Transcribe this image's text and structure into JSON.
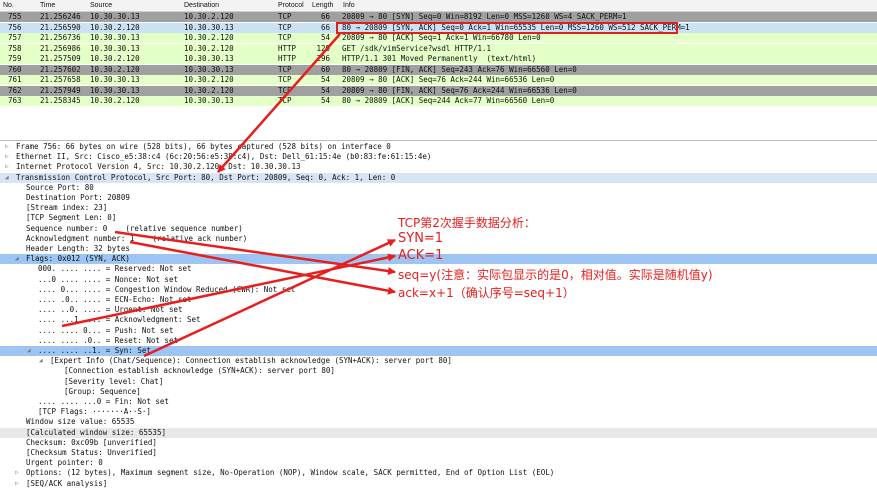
{
  "columns": [
    "No.",
    "Time",
    "Source",
    "Destination",
    "Protocol",
    "Length",
    "Info"
  ],
  "packets": [
    {
      "no": "755",
      "time": "21.256246",
      "src": "10.30.30.13",
      "dst": "10.30.2.120",
      "proto": "TCP",
      "len": "66",
      "info": "20809 → 80 [SYN] Seq=0 Win=8192 Len=0 MSS=1260 WS=4 SACK_PERM=1",
      "bg": "#a0a0a0"
    },
    {
      "no": "756",
      "time": "21.256590",
      "src": "10.30.2.120",
      "dst": "10.30.30.13",
      "proto": "TCP",
      "len": "66",
      "info": "80 → 20809 [SYN, ACK] Seq=0 Ack=1 Win=65535 Len=0 MSS=1260 WS=512 SACK_PERM=1",
      "bg": "#c9e3f5"
    },
    {
      "no": "757",
      "time": "21.256736",
      "src": "10.30.30.13",
      "dst": "10.30.2.120",
      "proto": "TCP",
      "len": "54",
      "info": "20809 → 80 [ACK] Seq=1 Ack=1 Win=66780 Len=0",
      "bg": "#e4ffc7"
    },
    {
      "no": "758",
      "time": "21.256986",
      "src": "10.30.30.13",
      "dst": "10.30.2.120",
      "proto": "HTTP",
      "len": "129",
      "info": "GET /sdk/vimService?wsdl HTTP/1.1",
      "bg": "#e4ffc7"
    },
    {
      "no": "759",
      "time": "21.257509",
      "src": "10.30.2.120",
      "dst": "10.30.30.13",
      "proto": "HTTP",
      "len": "296",
      "info": "HTTP/1.1 301 Moved Permanently  (text/html)",
      "bg": "#e4ffc7"
    },
    {
      "no": "760",
      "time": "21.257602",
      "src": "10.30.2.120",
      "dst": "10.30.30.13",
      "proto": "TCP",
      "len": "60",
      "info": "80 → 20809 [FIN, ACK] Seq=243 Ack=76 Win=66560 Len=0",
      "bg": "#a0a0a0"
    },
    {
      "no": "761",
      "time": "21.257658",
      "src": "10.30.30.13",
      "dst": "10.30.2.120",
      "proto": "TCP",
      "len": "54",
      "info": "20809 → 80 [ACK] Seq=76 Ack=244 Win=66536 Len=0",
      "bg": "#e4ffc7"
    },
    {
      "no": "762",
      "time": "21.257949",
      "src": "10.30.30.13",
      "dst": "10.30.2.120",
      "proto": "TCP",
      "len": "54",
      "info": "20809 → 80 [FIN, ACK] Seq=76 Ack=244 Win=66536 Len=0",
      "bg": "#a0a0a0"
    },
    {
      "no": "763",
      "time": "21.258345",
      "src": "10.30.2.120",
      "dst": "10.30.30.13",
      "proto": "TCP",
      "len": "54",
      "info": "80 → 20809 [ACK] Seq=244 Ack=77 Win=66560 Len=0",
      "bg": "#e4ffc7"
    }
  ],
  "details": [
    {
      "t": "Frame 756: 66 bytes on wire (528 bits), 66 bytes captured (528 bits) on interface 0",
      "lvl": 0,
      "exp": "closed"
    },
    {
      "t": "Ethernet II, Src: Cisco_e5:38:c4 (6c:20:56:e5:38:c4), Dst: Dell_61:15:4e (b0:83:fe:61:15:4e)",
      "lvl": 0,
      "exp": "closed"
    },
    {
      "t": "Internet Protocol Version 4, Src: 10.30.2.120, Dst: 10.30.30.13",
      "lvl": 0,
      "exp": "closed"
    },
    {
      "t": "Transmission Control Protocol, Src Port: 80, Dst Port: 20809, Seq: 0, Ack: 1, Len: 0",
      "lvl": 0,
      "exp": "open",
      "sel": "#d6e4f3"
    },
    {
      "t": "Source Port: 80",
      "lvl": 1
    },
    {
      "t": "Destination Port: 20809",
      "lvl": 1
    },
    {
      "t": "[Stream index: 23]",
      "lvl": 1
    },
    {
      "t": "[TCP Segment Len: 0]",
      "lvl": 1
    },
    {
      "t": "Sequence number: 0    (relative sequence number)",
      "lvl": 1
    },
    {
      "t": "Acknowledgment number: 1    (relative ack number)",
      "lvl": 1
    },
    {
      "t": "Header Length: 32 bytes",
      "lvl": 1
    },
    {
      "t": "Flags: 0x012 (SYN, ACK)",
      "lvl": 1,
      "exp": "open",
      "sel": "#9dc4f2"
    },
    {
      "t": "000. .... .... = Reserved: Not set",
      "lvl": 2
    },
    {
      "t": "...0 .... .... = Nonce: Not set",
      "lvl": 2
    },
    {
      "t": ".... 0... .... = Congestion Window Reduced (CWR): Not set",
      "lvl": 2
    },
    {
      "t": ".... .0.. .... = ECN-Echo: Not set",
      "lvl": 2
    },
    {
      "t": ".... ..0. .... = Urgent: Not set",
      "lvl": 2
    },
    {
      "t": ".... ...1 .... = Acknowledgment: Set",
      "lvl": 2
    },
    {
      "t": ".... .... 0... = Push: Not set",
      "lvl": 2
    },
    {
      "t": ".... .... .0.. = Reset: Not set",
      "lvl": 2
    },
    {
      "t": ".... .... ..1. = Syn: Set",
      "lvl": 2,
      "exp": "open",
      "sel": "#9dc4f2"
    },
    {
      "t": "[Expert Info (Chat/Sequence): Connection establish acknowledge (SYN+ACK): server port 80]",
      "lvl": 3,
      "exp": "open"
    },
    {
      "t": "[Connection establish acknowledge (SYN+ACK): server port 80]",
      "lvl": 4
    },
    {
      "t": "[Severity level: Chat]",
      "lvl": 4
    },
    {
      "t": "[Group: Sequence]",
      "lvl": 4
    },
    {
      "t": ".... .... ...0 = Fin: Not set",
      "lvl": 2
    },
    {
      "t": "[TCP Flags: ·······A··S·]",
      "lvl": 2
    },
    {
      "t": "Window size value: 65535",
      "lvl": 1
    },
    {
      "t": "[Calculated window size: 65535]",
      "lvl": 1,
      "sel": "#e8e8e8"
    },
    {
      "t": "Checksum: 0xc09b [unverified]",
      "lvl": 1
    },
    {
      "t": "[Checksum Status: Unverified]",
      "lvl": 1
    },
    {
      "t": "Urgent pointer: 0",
      "lvl": 1
    },
    {
      "t": "Options: (12 bytes), Maximum segment size, No-Operation (NOP), Window scale, SACK permitted, End of Option List (EOL)",
      "lvl": 1,
      "exp": "closed"
    },
    {
      "t": "[SEQ/ACK analysis]",
      "lvl": 1,
      "exp": "closed"
    }
  ],
  "annotations": {
    "title": "TCP第2次握手数据分析：",
    "syn": "SYN=1",
    "ack": "ACK=1",
    "seq": "seq=y(注意：实际包显示的是0，相对值。实际是随机值y)",
    "acknum": "ack=x+1（确认序号=seq+1）"
  },
  "colors": {
    "annotation": "#e81e1e",
    "selected_row": "#9dc4f2"
  }
}
